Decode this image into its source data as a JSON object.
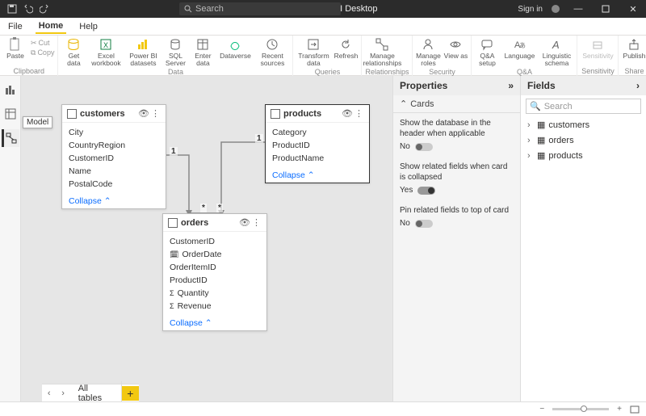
{
  "titlebar": {
    "title": "Untitled - Power BI Desktop",
    "search_placeholder": "Search",
    "signin": "Sign in"
  },
  "menu": {
    "file": "File",
    "home": "Home",
    "help": "Help"
  },
  "ribbon": {
    "clipboard": {
      "label": "Clipboard",
      "paste": "Paste",
      "cut": "Cut",
      "copy": "Copy"
    },
    "data": {
      "label": "Data",
      "get": "Get data",
      "excel": "Excel workbook",
      "pbi": "Power BI datasets",
      "sql": "SQL Server",
      "enter": "Enter data",
      "dataverse": "Dataverse",
      "recent": "Recent sources"
    },
    "queries": {
      "label": "Queries",
      "transform": "Transform data",
      "refresh": "Refresh"
    },
    "relationships": {
      "label": "Relationships",
      "manage": "Manage relationships"
    },
    "security": {
      "label": "Security",
      "roles": "Manage roles",
      "viewas": "View as"
    },
    "qa": {
      "label": "Q&A",
      "setup": "Q&A setup",
      "lang": "Language",
      "schema": "Linguistic schema"
    },
    "sensitivity": {
      "label": "Sensitivity",
      "btn": "Sensitivity"
    },
    "share": {
      "label": "Share",
      "publish": "Publish"
    }
  },
  "tooltip": "Model",
  "tables": {
    "customers": {
      "name": "customers",
      "fields": [
        "City",
        "CountryRegion",
        "CustomerID",
        "Name",
        "PostalCode"
      ],
      "collapse": "Collapse"
    },
    "products": {
      "name": "products",
      "fields": [
        "Category",
        "ProductID",
        "ProductName"
      ],
      "collapse": "Collapse"
    },
    "orders": {
      "name": "orders",
      "fields": [
        "CustomerID",
        "OrderDate",
        "OrderItemID",
        "ProductID",
        "Quantity",
        "Revenue"
      ],
      "collapse": "Collapse"
    }
  },
  "rel": {
    "one": "1",
    "many": "*"
  },
  "bottom": {
    "alltables": "All tables"
  },
  "properties": {
    "title": "Properties",
    "cards": "Cards",
    "p1": {
      "label": "Show the database in the header when applicable",
      "val": "No"
    },
    "p2": {
      "label": "Show related fields when card is collapsed",
      "val": "Yes"
    },
    "p3": {
      "label": "Pin related fields to top of card",
      "val": "No"
    }
  },
  "fields": {
    "title": "Fields",
    "search": "Search",
    "tables": [
      "customers",
      "orders",
      "products"
    ]
  }
}
